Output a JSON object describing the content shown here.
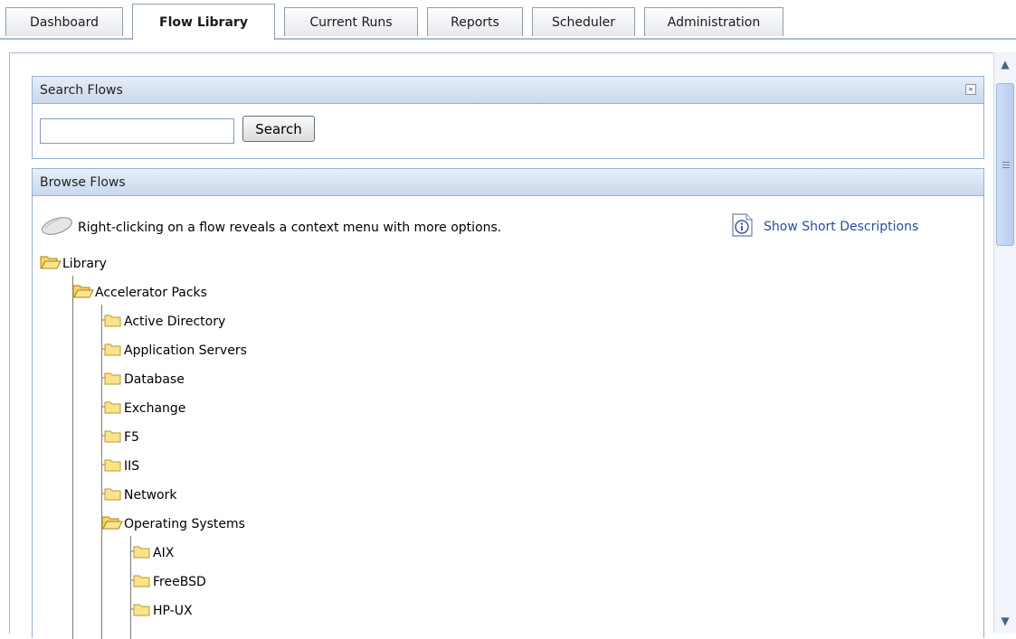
{
  "tabs": [
    {
      "label": "Dashboard",
      "active": false
    },
    {
      "label": "Flow Library",
      "active": true
    },
    {
      "label": "Current Runs",
      "active": false
    },
    {
      "label": "Reports",
      "active": false
    },
    {
      "label": "Scheduler",
      "active": false
    },
    {
      "label": "Administration",
      "active": false
    }
  ],
  "search_panel": {
    "title": "Search Flows",
    "input_value": "",
    "button_label": "Search"
  },
  "browse_panel": {
    "title": "Browse Flows",
    "hint": "Right-clicking on a flow reveals a context menu with more options.",
    "short_desc_link": "Show Short Descriptions",
    "tree": {
      "root": "Library",
      "packs": "Accelerator Packs",
      "folders": [
        "Active Directory",
        "Application Servers",
        "Database",
        "Exchange",
        "F5",
        "IIS",
        "Network"
      ],
      "open_folder": "Operating Systems",
      "os_children": [
        "AIX",
        "FreeBSD",
        "HP-UX"
      ]
    }
  },
  "colors": {
    "accent_border": "#99b2d1",
    "link": "#2a4d9b",
    "folder": "#f5c842"
  }
}
